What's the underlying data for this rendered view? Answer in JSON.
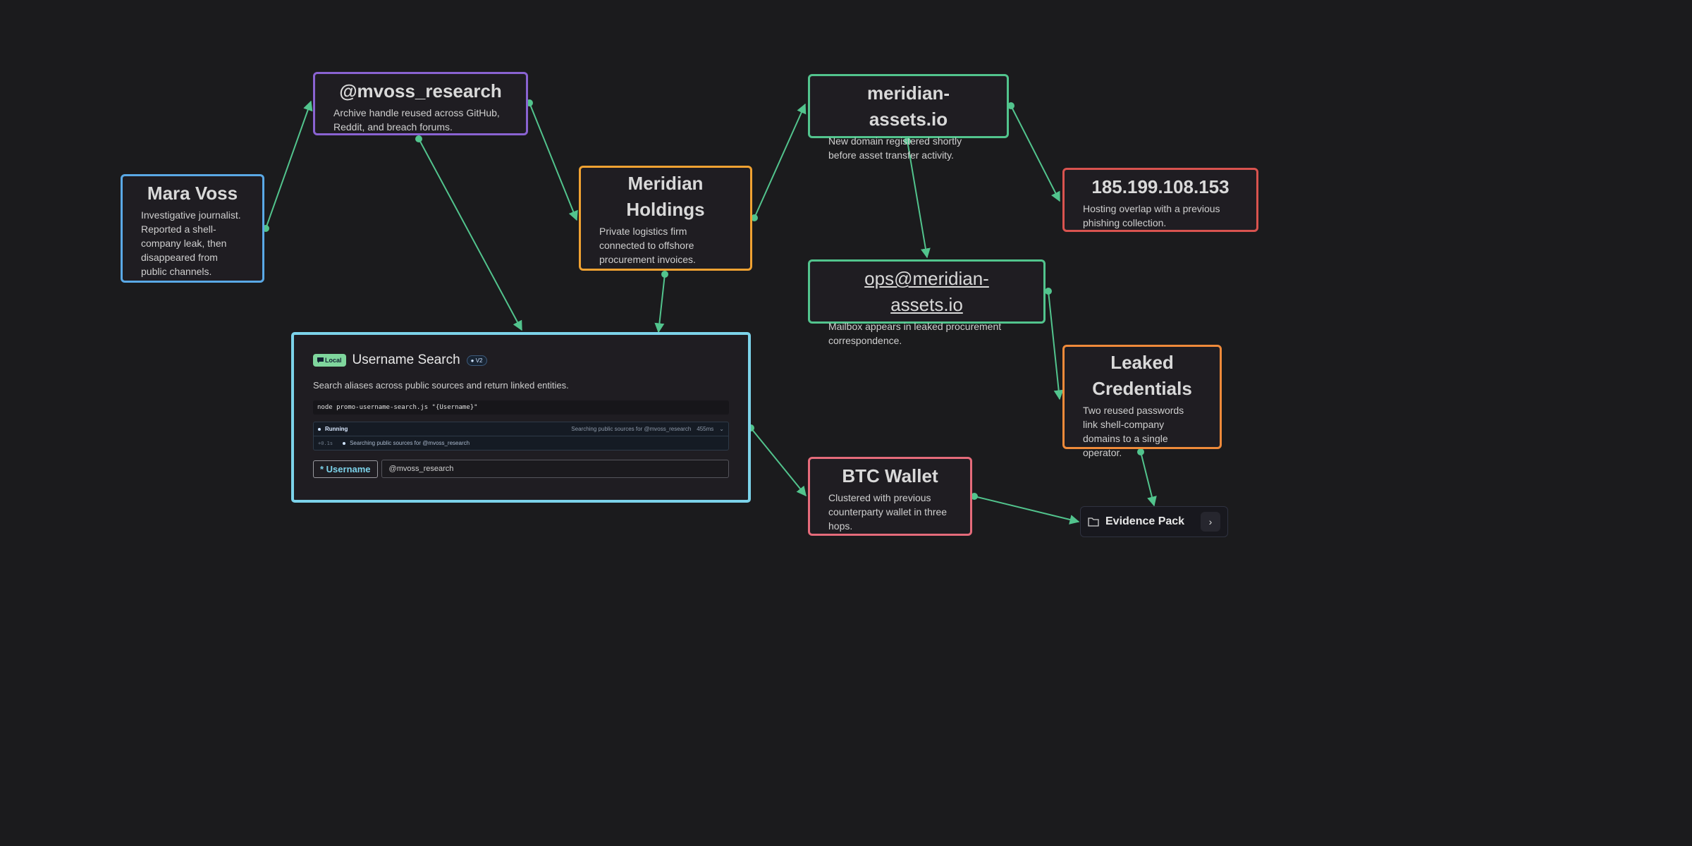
{
  "colors": {
    "background": "#1b1b1d",
    "edge": "#52c48d",
    "person": "#5aa9e6",
    "handle": "#8a63d2",
    "company": "#f0a232",
    "domain": "#52c48d",
    "ip": "#d9534f",
    "credentials": "#ef8a3a",
    "wallet": "#e56b7a",
    "tool": "#7cd3ea"
  },
  "nodes": {
    "mara": {
      "title": "Mara Voss",
      "desc": "Investigative journalist. Reported a shell-company leak, then disappeared from public channels."
    },
    "handle": {
      "title": "@mvoss_research",
      "desc": "Archive handle reused across GitHub, Reddit, and breach forums."
    },
    "meridian": {
      "title": "Meridian Holdings",
      "desc": "Private logistics firm connected to offshore procurement invoices."
    },
    "domain": {
      "title": "meridian-assets.io",
      "desc": "New domain registered shortly before asset transfer activity."
    },
    "ip": {
      "title": "185.199.108.153",
      "desc": "Hosting overlap with a previous phishing collection."
    },
    "email": {
      "title": "ops@meridian-assets.io",
      "desc": "Mailbox appears in leaked procurement correspondence."
    },
    "creds": {
      "title": "Leaked Credentials",
      "desc": "Two reused passwords link shell-company domains to a single operator."
    },
    "btc": {
      "title": "BTC Wallet",
      "desc": "Clustered with previous counterparty wallet in three hops."
    }
  },
  "tool": {
    "badge": "Local",
    "title": "Username Search",
    "version": "V2",
    "desc": "Search aliases across public sources and return linked entities.",
    "command": "node promo-username-search.js \"{Username}\"",
    "run": {
      "status": "Running",
      "meta": "Searching public sources for @mvoss_research",
      "elapsed": "455ms",
      "log_time": "+0.1s",
      "log_msg": "Searching public sources for @mvoss_research"
    },
    "field": {
      "label": "* Username",
      "value": "@mvoss_research"
    }
  },
  "evidence": {
    "label": "Evidence Pack",
    "icon": "folder-icon",
    "button_icon": "chevron-right-icon"
  }
}
